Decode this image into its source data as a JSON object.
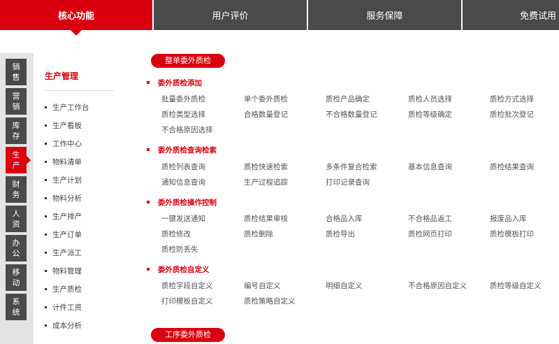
{
  "tabs": [
    {
      "label": "核心功能",
      "active": true
    },
    {
      "label": "用户评价",
      "active": false
    },
    {
      "label": "服务保障",
      "active": false
    },
    {
      "label": "免费试用",
      "active": false
    }
  ],
  "sidebar": {
    "vtabs": [
      {
        "line1": "销",
        "line2": "售",
        "active": false
      },
      {
        "line1": "营",
        "line2": "销",
        "active": false
      },
      {
        "line1": "库",
        "line2": "存",
        "active": false
      },
      {
        "line1": "生",
        "line2": "产",
        "active": true
      },
      {
        "line1": "财",
        "line2": "务",
        "active": false
      },
      {
        "line1": "人",
        "line2": "资",
        "active": false
      },
      {
        "line1": "办",
        "line2": "公",
        "active": false
      },
      {
        "line1": "移",
        "line2": "动",
        "active": false
      },
      {
        "line1": "系",
        "line2": "统",
        "active": false
      }
    ],
    "panel_title": "生产管理",
    "items": [
      "生产工作台",
      "生产看板",
      "工作中心",
      "物料清单",
      "生产计划",
      "物料分析",
      "生产排产",
      "生产订单",
      "生产派工",
      "物料管理",
      "生产质检",
      "计件工资",
      "成本分析"
    ]
  },
  "main": {
    "group1_label": "整单委外质检",
    "group2_label": "工序委外质检",
    "sections": [
      {
        "title": "委外质检添加",
        "items": [
          "批量委外质检",
          "单个委外质检",
          "质检产品确定",
          "质检人员选择",
          "质检方式选择",
          "质检类型选择",
          "合格数量登记",
          "不合格数量登记",
          "质检等级确定",
          "质检批次登记",
          "不合格原因选择"
        ]
      },
      {
        "title": "委外质检查询检索",
        "items": [
          "质检列表查询",
          "质检快速检索",
          "多条件复合检索",
          "基本信息查询",
          "质检结果查询",
          "通知信息查询",
          "生产过程追踪",
          "打印记录查询"
        ]
      },
      {
        "title": "委外质检操作控制",
        "items": [
          "一键发送通知",
          "质检结果审核",
          "合格品入库",
          "不合格品返工",
          "报废品入库",
          "质检修改",
          "质检删除",
          "质检导出",
          "质检网页打印",
          "质检模板打印",
          "质检防丢失"
        ]
      },
      {
        "title": "委外质检自定义",
        "items": [
          "质检字段自定义",
          "编号自定义",
          "明细自定义",
          "不合格原因自定义",
          "质检等级自定义",
          "打印模板自定义",
          "质检策略自定义"
        ]
      }
    ]
  },
  "colors": {
    "accent": "#d9000f",
    "dark": "#4a4a4a",
    "sidebar_bg": "#e4e4e4"
  }
}
